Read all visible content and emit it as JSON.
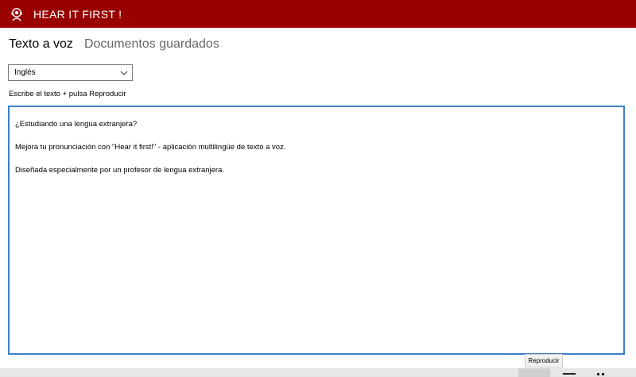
{
  "app": {
    "title": "HEAR IT FIRST !",
    "icon": "headphones-person-icon",
    "brand_color": "#990000"
  },
  "tabs": [
    {
      "label": "Texto a voz",
      "active": true
    },
    {
      "label": "Documentos guardados",
      "active": false
    }
  ],
  "language_select": {
    "value": "Inglés",
    "icon": "chevron-down-icon"
  },
  "instruction": "Escribe el texto + pulsa Reproducir",
  "editor": {
    "paragraphs": [
      "¿Estudiando una lengua extranjera?",
      "Mejora tu pronunciación con \"Hear it first!\" - aplicación multilingüe de texto a voz.",
      "Diseñada especialmente por un profesor de lengua extranjera."
    ],
    "border_color": "#3a7fc8"
  },
  "tooltip": "Reproducir"
}
